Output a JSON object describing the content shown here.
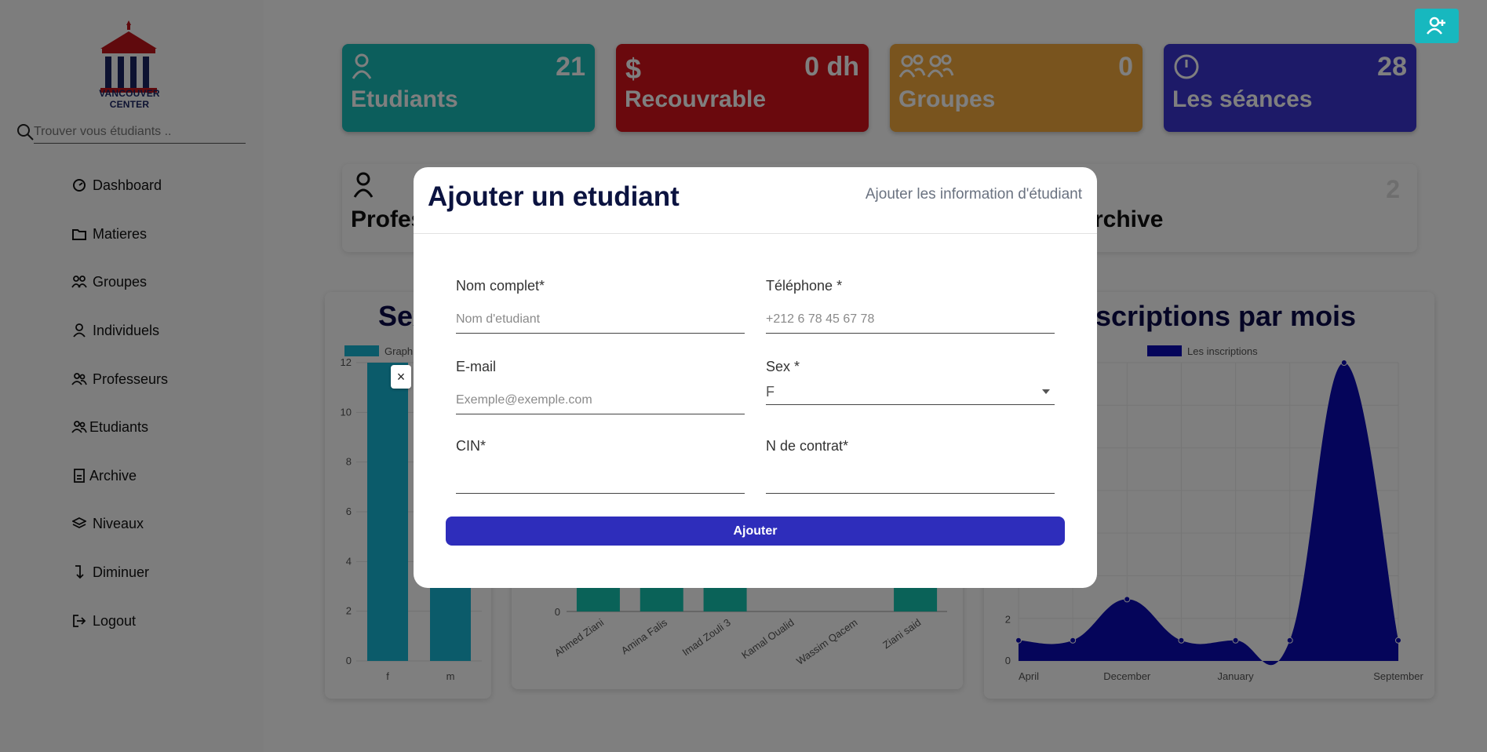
{
  "app": {
    "logo_text": "VANCOUVER CENTER",
    "search_placeholder": "Trouver vous étudiants .."
  },
  "sidebar": {
    "items": [
      {
        "label": "Dashboard",
        "icon": "dashboard-icon"
      },
      {
        "label": "Matieres",
        "icon": "folder-icon"
      },
      {
        "label": "Groupes",
        "icon": "groups-icon"
      },
      {
        "label": "Individuels",
        "icon": "person-icon"
      },
      {
        "label": "Professeurs",
        "icon": "people-icon"
      },
      {
        "label": "Etudiants",
        "icon": "people-icon"
      },
      {
        "label": "Archive",
        "icon": "archive-icon"
      },
      {
        "label": "Niveaux",
        "icon": "layers-icon"
      },
      {
        "label": "Diminuer",
        "icon": "arrow-down-icon"
      },
      {
        "label": "Logout",
        "icon": "logout-icon"
      }
    ]
  },
  "stats": [
    {
      "label": "Etudiants",
      "value": "21",
      "color": "#18bdb8",
      "icon": "person-icon"
    },
    {
      "label": "Recouvrable",
      "value": "0 dh",
      "color": "#d4131b",
      "icon": "dollar-icon"
    },
    {
      "label": "Groupes",
      "value": "0",
      "color": "#f3a93c",
      "icon": "groups-icon"
    },
    {
      "label": "Les séances",
      "value": "28",
      "color": "#3a35d1",
      "icon": "clock-icon"
    }
  ],
  "stats2": [
    {
      "label": "Profes",
      "value": ""
    },
    {
      "label": "rchive",
      "value": "2"
    }
  ],
  "charts": {
    "sex_title": "Sex",
    "sex_legend_partial": "Graph",
    "inscriptions_title": "nscriptions par mois",
    "inscriptions_legend": "Les inscriptions"
  },
  "chart_data": [
    {
      "type": "bar",
      "title": "Sex",
      "categories": [
        "f",
        "m"
      ],
      "series": [
        {
          "name": "Graph",
          "values": [
            12,
            12
          ]
        }
      ],
      "ylim": [
        0,
        12
      ],
      "yticks": [
        0,
        2,
        4,
        6,
        8,
        10,
        12
      ],
      "color": "#17b7d4"
    },
    {
      "type": "bar",
      "categories": [
        "Ahmed Ziani",
        "Amina Falis",
        "Imad Zouli 3",
        "Kamal Oualid",
        "Wassim Qacem",
        "Ziani said"
      ],
      "values": [
        1,
        1,
        1,
        0,
        0,
        1
      ],
      "yticks": [
        0
      ],
      "color": "#14c4b0"
    },
    {
      "type": "area",
      "x": [
        "April",
        "",
        "December",
        "",
        "January",
        "",
        "",
        "September"
      ],
      "series": [
        {
          "name": "Les inscriptions",
          "values": [
            1,
            1,
            3,
            1,
            1,
            1,
            14.5,
            1
          ]
        }
      ],
      "xticks": [
        "April",
        "December",
        "January",
        "September"
      ],
      "yticks": [
        0,
        2
      ],
      "color": "#0a0ab5"
    }
  ],
  "modal": {
    "title": "Ajouter un etudiant",
    "subtitle": "Ajouter les information d'étudiant",
    "fields": {
      "nom": {
        "label": "Nom complet*",
        "placeholder": "Nom d'etudiant"
      },
      "telephone": {
        "label": "Téléphone *",
        "placeholder": "+212 6 78 45 67 78"
      },
      "email": {
        "label": "E-mail",
        "placeholder": "Exemple@exemple.com"
      },
      "sex": {
        "label": "Sex *",
        "value": "F"
      },
      "cin": {
        "label": "CIN*"
      },
      "contrat": {
        "label": "N de contrat*"
      }
    },
    "submit_label": "Ajouter",
    "close_label": "×"
  }
}
